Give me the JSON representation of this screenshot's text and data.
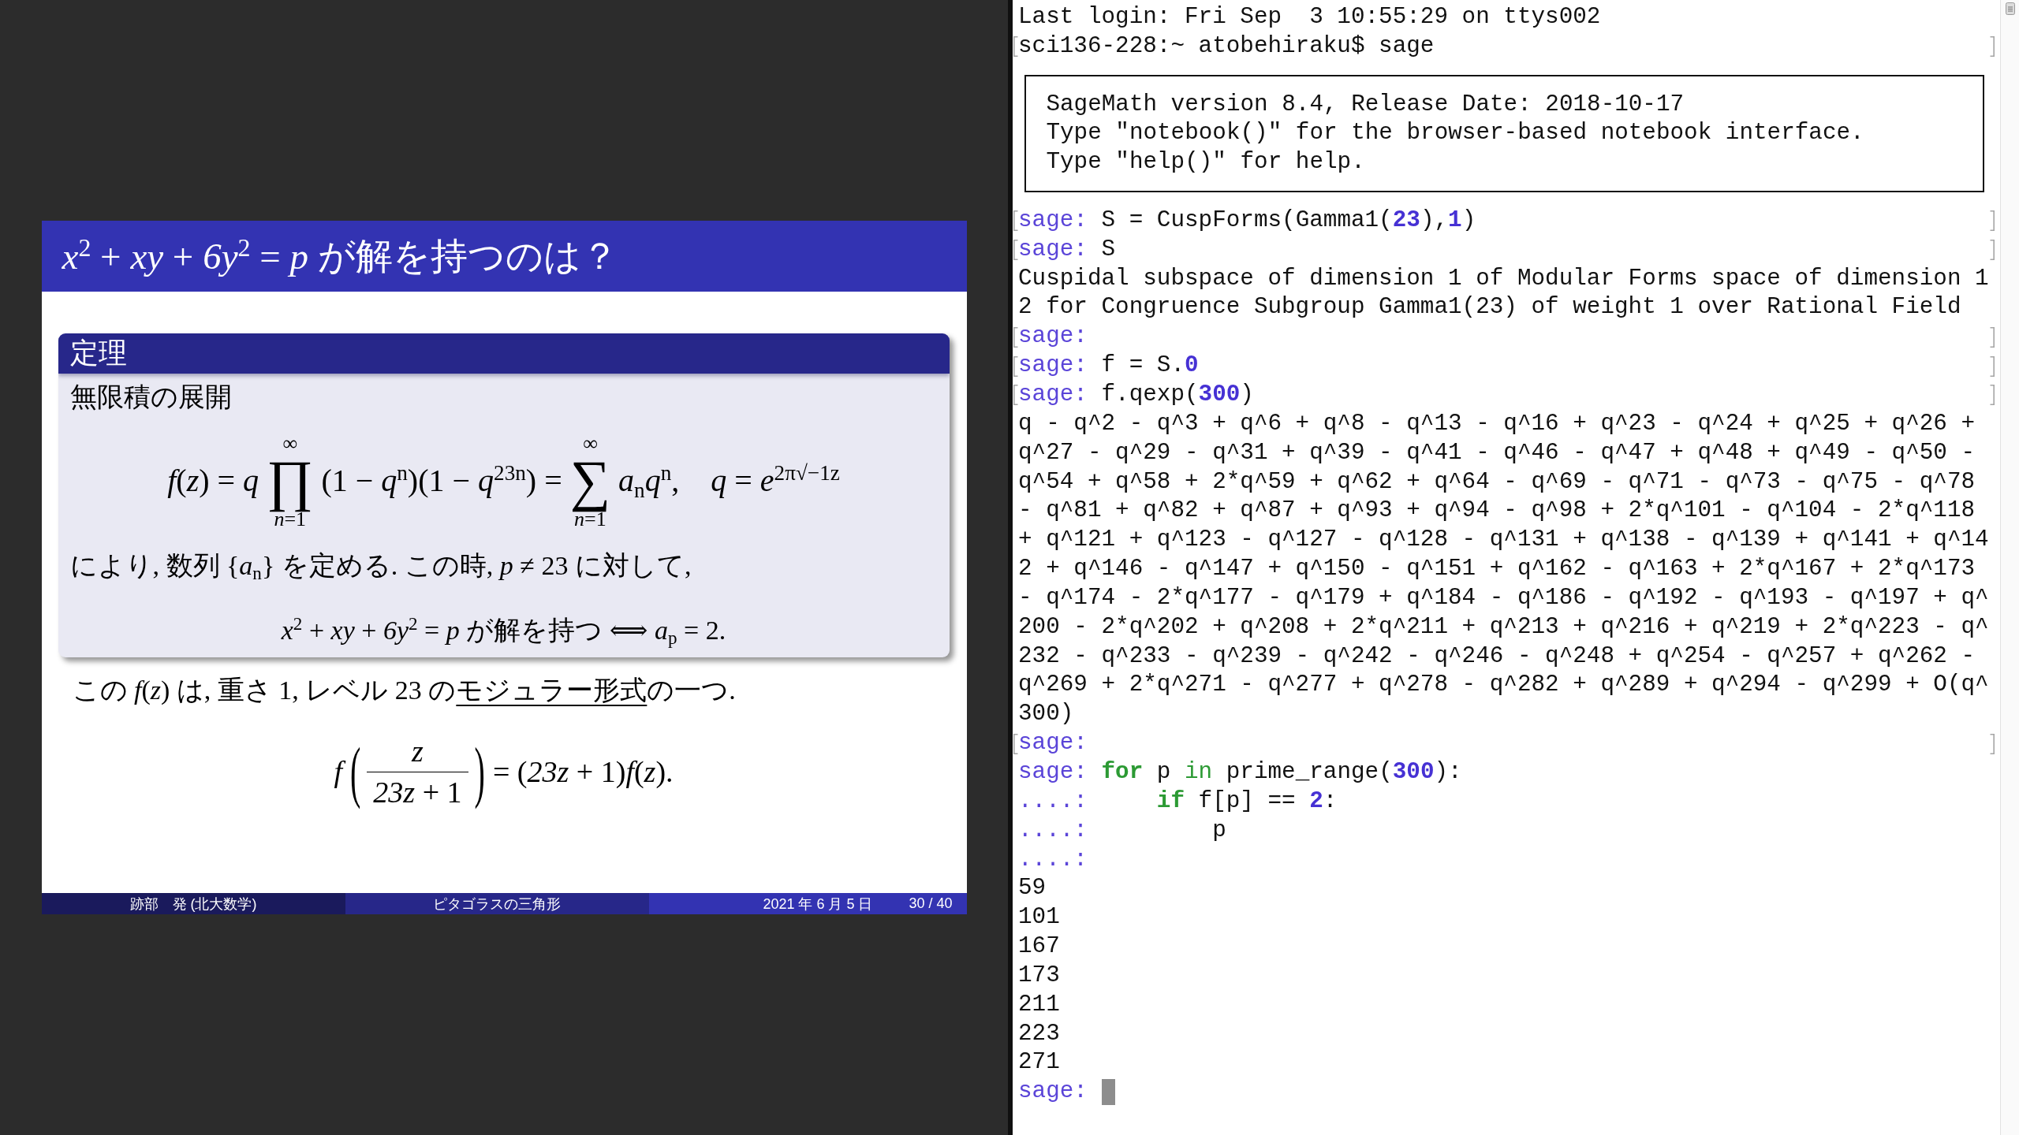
{
  "slide": {
    "title": "*x*$^{2}$ + *xy* + *6y*$^{2}$ = *p* が解を持つのは？",
    "block": {
      "title": "定理",
      "intro": "無限積の展開",
      "formula": {
        "parts": [
          {
            "kind": "text",
            "text": "*f*(*z*) = *q*"
          },
          {
            "kind": "bigop",
            "symbol": "∏",
            "upper": "∞",
            "lower": "*n*=1"
          },
          {
            "kind": "text",
            "text": "(1 − *q*$^{n}$)(1 − *q*$^{23n}$) ="
          },
          {
            "kind": "bigop",
            "symbol": "∑",
            "upper": "∞",
            "lower": "*n*=1"
          },
          {
            "kind": "text",
            "text": "*a*$_{n}$*q*$^{n}$,    *q* = *e*$^{2π√−1z}$"
          }
        ]
      },
      "text": "により, 数列 {*a*$_{n}$} を定める. この時, *p* ≠ 23 に対して,",
      "equivalence": "*x*$^{2}$ + *xy* + *6y*$^{2}$ = *p* が解を持つ ⟺ *a*$_{p}$ = 2."
    },
    "note": {
      "before": "この *f*(*z*) は, 重さ 1, レベル 23 の",
      "link": "モジュラー形式",
      "after": "の一つ."
    },
    "formula": {
      "parts": [
        {
          "kind": "text",
          "text": "*f*"
        },
        {
          "kind": "fraction",
          "open": "(",
          "numerator": "*z*",
          "denominator": "*23z* + 1",
          "close": ")"
        },
        {
          "kind": "text",
          "text": "= (*23z* + 1)*f*(*z*)."
        }
      ]
    },
    "footline": {
      "author": "跡部　発 (北大数学)",
      "title": "ピタゴラスの三角形",
      "date": "2021 年 6 月 5 日",
      "page": "30 / 40"
    }
  },
  "terminal": {
    "header": [
      {
        "marked": false,
        "segments": [
          {
            "kind": "plain",
            "text": "Last login: Fri Sep  3 10:55:29 on ttys002"
          }
        ]
      },
      {
        "marked": true,
        "segments": [
          {
            "kind": "plain",
            "text": "sci136-228:~ atobehiraku$ sage"
          }
        ]
      }
    ],
    "banner": [
      "SageMath version 8.4, Release Date: 2018-10-17",
      "Type \"notebook()\" for the browser-based notebook interface.",
      "Type \"help()\" for help."
    ],
    "lines": [
      {
        "marked": true,
        "segments": [
          {
            "kind": "prompt",
            "text": "sage: "
          },
          {
            "kind": "plain",
            "text": "S = CuspForms(Gamma1("
          },
          {
            "kind": "number",
            "text": "23"
          },
          {
            "kind": "plain",
            "text": "),"
          },
          {
            "kind": "number",
            "text": "1"
          },
          {
            "kind": "plain",
            "text": ")"
          }
        ]
      },
      {
        "marked": true,
        "segments": [
          {
            "kind": "prompt",
            "text": "sage: "
          },
          {
            "kind": "plain",
            "text": "S"
          }
        ]
      },
      {
        "marked": false,
        "segments": [
          {
            "kind": "plain",
            "text": "Cuspidal subspace of dimension 1 of Modular Forms space of dimension 1"
          }
        ]
      },
      {
        "marked": false,
        "segments": [
          {
            "kind": "plain",
            "text": "2 for Congruence Subgroup Gamma1(23) of weight 1 over Rational Field"
          }
        ]
      },
      {
        "marked": true,
        "segments": [
          {
            "kind": "prompt",
            "text": "sage:"
          }
        ]
      },
      {
        "marked": true,
        "segments": [
          {
            "kind": "prompt",
            "text": "sage: "
          },
          {
            "kind": "plain",
            "text": "f = S."
          },
          {
            "kind": "number",
            "text": "0"
          }
        ]
      },
      {
        "marked": true,
        "segments": [
          {
            "kind": "prompt",
            "text": "sage: "
          },
          {
            "kind": "plain",
            "text": "f.qexp("
          },
          {
            "kind": "number",
            "text": "300"
          },
          {
            "kind": "plain",
            "text": ")"
          }
        ]
      },
      {
        "marked": false,
        "segments": [
          {
            "kind": "plain",
            "text": "q - q^2 - q^3 + q^6 + q^8 - q^13 - q^16 + q^23 - q^24 + q^25 + q^26 +"
          }
        ]
      },
      {
        "marked": false,
        "segments": [
          {
            "kind": "plain",
            "text": "q^27 - q^29 - q^31 + q^39 - q^41 - q^46 - q^47 + q^48 + q^49 - q^50 -"
          }
        ]
      },
      {
        "marked": false,
        "segments": [
          {
            "kind": "plain",
            "text": "q^54 + q^58 + 2*q^59 + q^62 + q^64 - q^69 - q^71 - q^73 - q^75 - q^78"
          }
        ]
      },
      {
        "marked": false,
        "segments": [
          {
            "kind": "plain",
            "text": "- q^81 + q^82 + q^87 + q^93 + q^94 - q^98 + 2*q^101 - q^104 - 2*q^118"
          }
        ]
      },
      {
        "marked": false,
        "segments": [
          {
            "kind": "plain",
            "text": "+ q^121 + q^123 - q^127 - q^128 - q^131 + q^138 - q^139 + q^141 + q^14"
          }
        ]
      },
      {
        "marked": false,
        "segments": [
          {
            "kind": "plain",
            "text": "2 + q^146 - q^147 + q^150 - q^151 + q^162 - q^163 + 2*q^167 + 2*q^173"
          }
        ]
      },
      {
        "marked": false,
        "segments": [
          {
            "kind": "plain",
            "text": "- q^174 - 2*q^177 - q^179 + q^184 - q^186 - q^192 - q^193 - q^197 + q^"
          }
        ]
      },
      {
        "marked": false,
        "segments": [
          {
            "kind": "plain",
            "text": "200 - 2*q^202 + q^208 + 2*q^211 + q^213 + q^216 + q^219 + 2*q^223 - q^"
          }
        ]
      },
      {
        "marked": false,
        "segments": [
          {
            "kind": "plain",
            "text": "232 - q^233 - q^239 - q^242 - q^246 - q^248 + q^254 - q^257 + q^262 -"
          }
        ]
      },
      {
        "marked": false,
        "segments": [
          {
            "kind": "plain",
            "text": "q^269 + 2*q^271 - q^277 + q^278 - q^282 + q^289 + q^294 - q^299 + O(q^"
          }
        ]
      },
      {
        "marked": false,
        "segments": [
          {
            "kind": "plain",
            "text": "300)"
          }
        ]
      },
      {
        "marked": true,
        "segments": [
          {
            "kind": "prompt",
            "text": "sage:"
          }
        ]
      },
      {
        "marked": false,
        "segments": [
          {
            "kind": "prompt",
            "text": "sage: "
          },
          {
            "kind": "keyword",
            "text": "for"
          },
          {
            "kind": "plain",
            "text": " p "
          },
          {
            "kind": "operator",
            "text": "in"
          },
          {
            "kind": "plain",
            "text": " prime_range("
          },
          {
            "kind": "number",
            "text": "300"
          },
          {
            "kind": "plain",
            "text": "):"
          }
        ]
      },
      {
        "marked": false,
        "segments": [
          {
            "kind": "prompt",
            "text": "....:     "
          },
          {
            "kind": "keyword",
            "text": "if"
          },
          {
            "kind": "plain",
            "text": " f[p] == "
          },
          {
            "kind": "number",
            "text": "2"
          },
          {
            "kind": "plain",
            "text": ":"
          }
        ]
      },
      {
        "marked": false,
        "segments": [
          {
            "kind": "prompt",
            "text": "....:"
          },
          {
            "kind": "plain",
            "text": "         p"
          }
        ]
      },
      {
        "marked": false,
        "segments": [
          {
            "kind": "prompt",
            "text": "....:"
          }
        ]
      },
      {
        "marked": false,
        "segments": [
          {
            "kind": "plain",
            "text": "59"
          }
        ]
      },
      {
        "marked": false,
        "segments": [
          {
            "kind": "plain",
            "text": "101"
          }
        ]
      },
      {
        "marked": false,
        "segments": [
          {
            "kind": "plain",
            "text": "167"
          }
        ]
      },
      {
        "marked": false,
        "segments": [
          {
            "kind": "plain",
            "text": "173"
          }
        ]
      },
      {
        "marked": false,
        "segments": [
          {
            "kind": "plain",
            "text": "211"
          }
        ]
      },
      {
        "marked": false,
        "segments": [
          {
            "kind": "plain",
            "text": "223"
          }
        ]
      },
      {
        "marked": false,
        "segments": [
          {
            "kind": "plain",
            "text": "271"
          }
        ]
      },
      {
        "marked": false,
        "segments": [
          {
            "kind": "prompt",
            "text": "sage: "
          }
        ]
      }
    ],
    "cursor": true
  }
}
